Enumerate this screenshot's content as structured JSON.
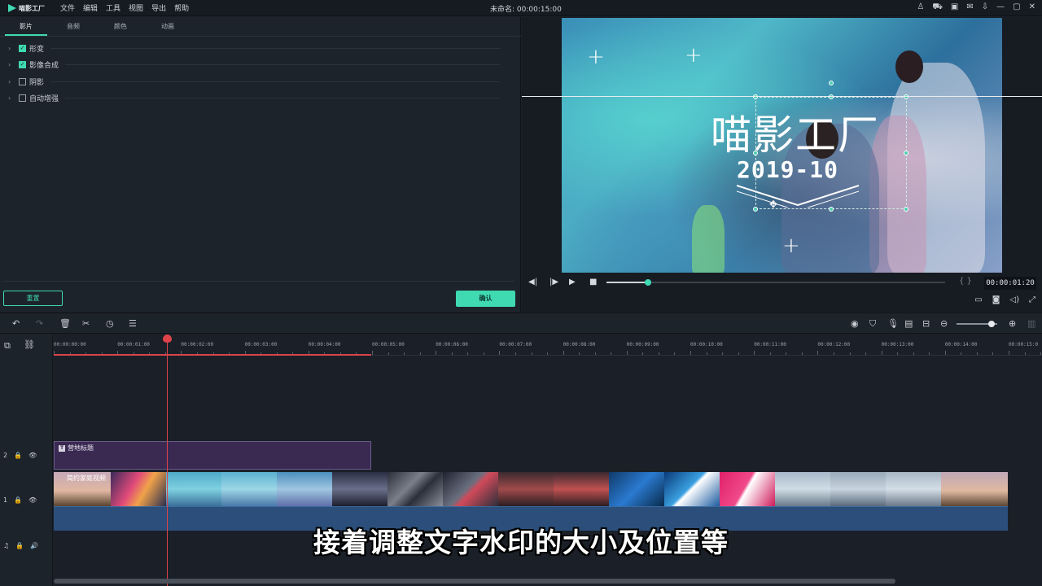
{
  "app": {
    "name": "喵影工厂",
    "document_title": "未命名: 00:00:15:00"
  },
  "menu": [
    "文件",
    "编辑",
    "工具",
    "视图",
    "导出",
    "帮助"
  ],
  "left_panel": {
    "tabs": [
      "影片",
      "音频",
      "颜色",
      "动画"
    ],
    "active_tab": 0,
    "properties": [
      {
        "label": "形变",
        "checked": true
      },
      {
        "label": "影像合成",
        "checked": true
      },
      {
        "label": "阴影",
        "checked": false
      },
      {
        "label": "自动增强",
        "checked": false
      }
    ],
    "reset_label": "重置",
    "ok_label": "确认"
  },
  "preview": {
    "watermark_title": "喵影工厂",
    "watermark_date": "2019-10",
    "timecode": "00:00:01:20",
    "playback_progress": 0.12
  },
  "timeline": {
    "ruler_labels": [
      "00:00:00:00",
      "00:00:01:00",
      "00:00:02:00",
      "00:00:03:00",
      "00:00:04:00",
      "00:00:05:00",
      "00:00:06:00",
      "00:00:07:00",
      "00:00:08:00",
      "00:00:09:00",
      "00:00:10:00",
      "00:00:11:00",
      "00:00:12:00",
      "00:00:13:00",
      "00:00:14:00",
      "00:00:15:0"
    ],
    "title_clip_label": "营地标题",
    "video_clip_label": "简约家庭视频",
    "track_labels": [
      "2",
      "1"
    ]
  },
  "subtitle": "接着调整文字水印的大小及位置等",
  "colors": {
    "accent": "#3fd9b2",
    "playhead": "#e0424a",
    "title_clip": "#3a2a52",
    "audio_strip": "#2b4f7a"
  }
}
